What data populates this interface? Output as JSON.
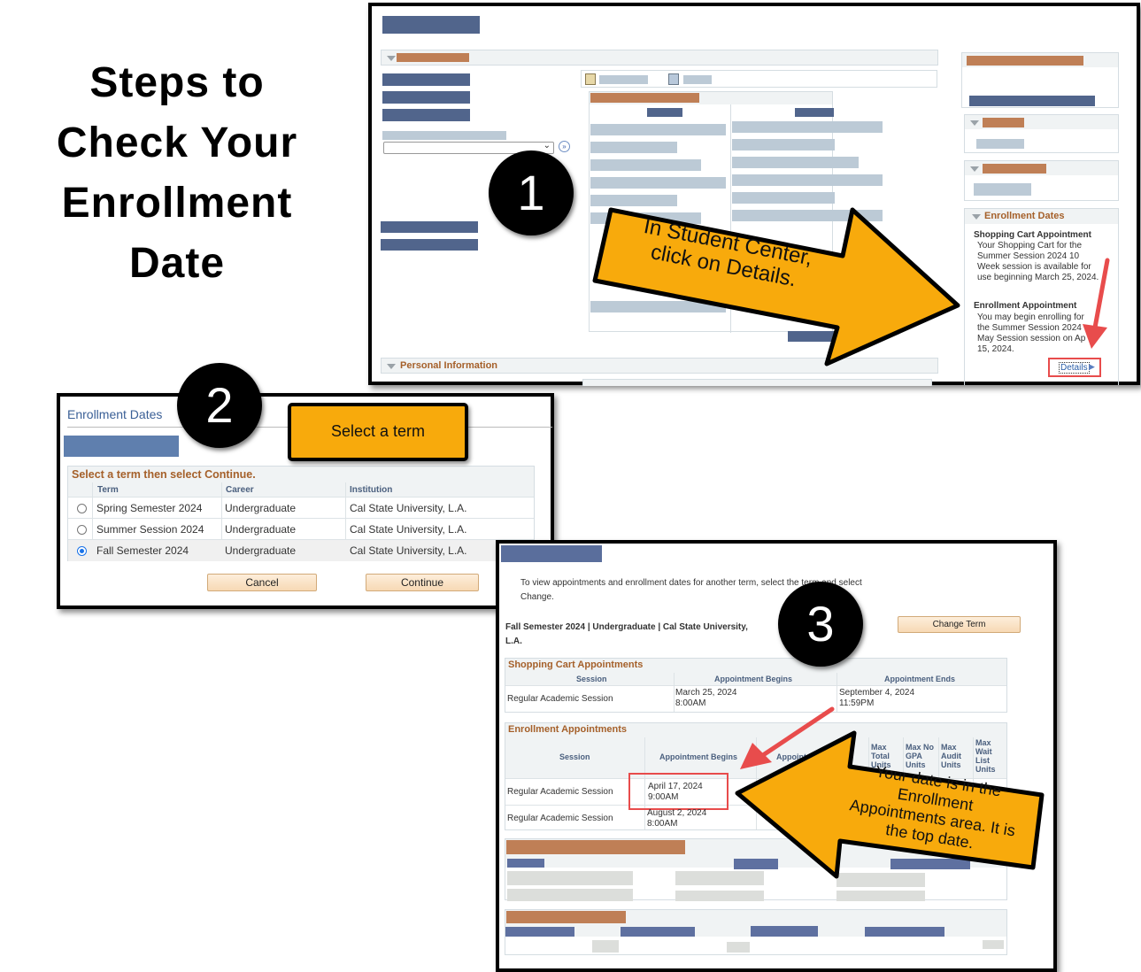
{
  "title": {
    "lines": [
      "Steps to",
      "Check Your",
      "Enrollment",
      "Date"
    ]
  },
  "colors": {
    "callout": "#f8aa0c",
    "highlight_red": "#e84c4c",
    "section_header": "#a5602a",
    "navy_placeholder": "#51658c",
    "orange_placeholder": "#bf7f56"
  },
  "step1": {
    "badge": "1",
    "callout": "In Student Center, click on Details.",
    "callout_lines": [
      "In Student Center,",
      "click on Details."
    ],
    "personal_info_header": "Personal Information",
    "enrollment_dates": {
      "header": "Enrollment Dates",
      "shopping_cart_title": "Shopping Cart Appointment",
      "shopping_cart_lines": [
        "Your Shopping Cart for the",
        "Summer Session 2024 10",
        "Week session is available for",
        "use beginning March 25, 2024."
      ],
      "enrollment_title": "Enrollment Appointment",
      "enrollment_lines": [
        "You may begin enrolling for",
        "the Summer Session 2024",
        "May Session session on Ap",
        "15, 2024."
      ],
      "details_link": "Details"
    }
  },
  "step2": {
    "badge": "2",
    "page_title": "Enrollment Dates",
    "callout": "Select a term",
    "grid_title": "Select a term then select Continue.",
    "columns": [
      "Term",
      "Career",
      "Institution"
    ],
    "rows": [
      {
        "term": "Spring Semester 2024",
        "career": "Undergraduate",
        "institution": "Cal State University, L.A.",
        "selected": false
      },
      {
        "term": "Summer Session 2024",
        "career": "Undergraduate",
        "institution": "Cal State University, L.A.",
        "selected": false
      },
      {
        "term": "Fall Semester 2024",
        "career": "Undergraduate",
        "institution": "Cal State University, L.A.",
        "selected": true
      }
    ],
    "cancel_button": "Cancel",
    "continue_button": "Continue"
  },
  "step3": {
    "badge": "3",
    "instructions_line1": "To view appointments and enrollment dates for another term, select the term and select",
    "instructions_line2": "Change.",
    "term_line1": "Fall Semester 2024 | Undergraduate | Cal State University,",
    "term_line2": "L.A.",
    "change_term_button": "Change Term",
    "shopping_cart": {
      "title": "Shopping Cart Appointments",
      "columns": [
        "Session",
        "Appointment Begins",
        "Appointment Ends"
      ],
      "rows": [
        {
          "session": "Regular Academic Session",
          "begins_date": "March 25, 2024",
          "begins_time": "8:00AM",
          "ends_date": "September 4, 2024",
          "ends_time": "11:59PM"
        }
      ]
    },
    "enrollment": {
      "title": "Enrollment Appointments",
      "columns": [
        "Session",
        "Appointment Begins",
        "Appoint",
        "Max Total Units",
        "Max No GPA Units",
        "Max Audit Units",
        "Max Wait List Units"
      ],
      "col_lines": {
        "max_total": [
          "Max",
          "Total",
          "Units"
        ],
        "max_nogpa": [
          "Max No",
          "GPA",
          "Units"
        ],
        "max_audit": [
          "Max",
          "Audit",
          "Units"
        ],
        "max_wait": [
          "Max",
          "Wait",
          "List",
          "Units"
        ]
      },
      "rows": [
        {
          "session": "Regular Academic Session",
          "begins_date": "April 17, 2024",
          "begins_time": "9:00AM"
        },
        {
          "session": "Regular Academic Session",
          "begins_date": "August 2, 2024",
          "begins_time": "8:00AM"
        }
      ]
    },
    "callout_lines": [
      "Your date is in the",
      "Enrollment",
      "Appointments area. It is",
      "the top date."
    ]
  }
}
